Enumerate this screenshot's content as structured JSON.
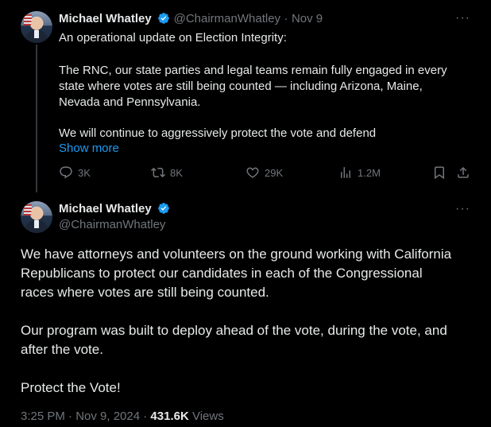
{
  "tweet1": {
    "name": "Michael Whatley",
    "handle": "@ChairmanWhatley",
    "separator": "·",
    "date": "Nov 9",
    "line1": "An operational update on Election Integrity:",
    "para2_l1": "The RNC, our state parties and legal teams remain fully engaged in every",
    "para2_l2": "state where votes are still being counted — including Arizona, Maine,",
    "para2_l3": "Nevada and Pennsylvania.",
    "para3": "We will continue to aggressively protect the vote and defend",
    "show_more": "Show more",
    "replies": "3K",
    "reposts": "8K",
    "likes": "29K",
    "views": "1.2M",
    "more": "···"
  },
  "tweet2": {
    "name": "Michael Whatley",
    "handle": "@ChairmanWhatley",
    "more": "···",
    "p1_l1": "We have attorneys and volunteers on the ground working with California",
    "p1_l2": "Republicans to protect our candidates in each of the Congressional",
    "p1_l3": "races where votes are still being counted.",
    "p2_l1": "Our program was built to deploy ahead of the vote, during the vote, and",
    "p2_l2": "after the vote.",
    "p3": "Protect the Vote!",
    "time": "3:25 PM · Nov 9, 2024 · ",
    "views_count": "431.6K",
    "views_label": " Views"
  },
  "colors": {
    "background": "#000000",
    "text": "#e7e9ea",
    "muted": "#71767b",
    "accent": "#1d9bf0"
  }
}
